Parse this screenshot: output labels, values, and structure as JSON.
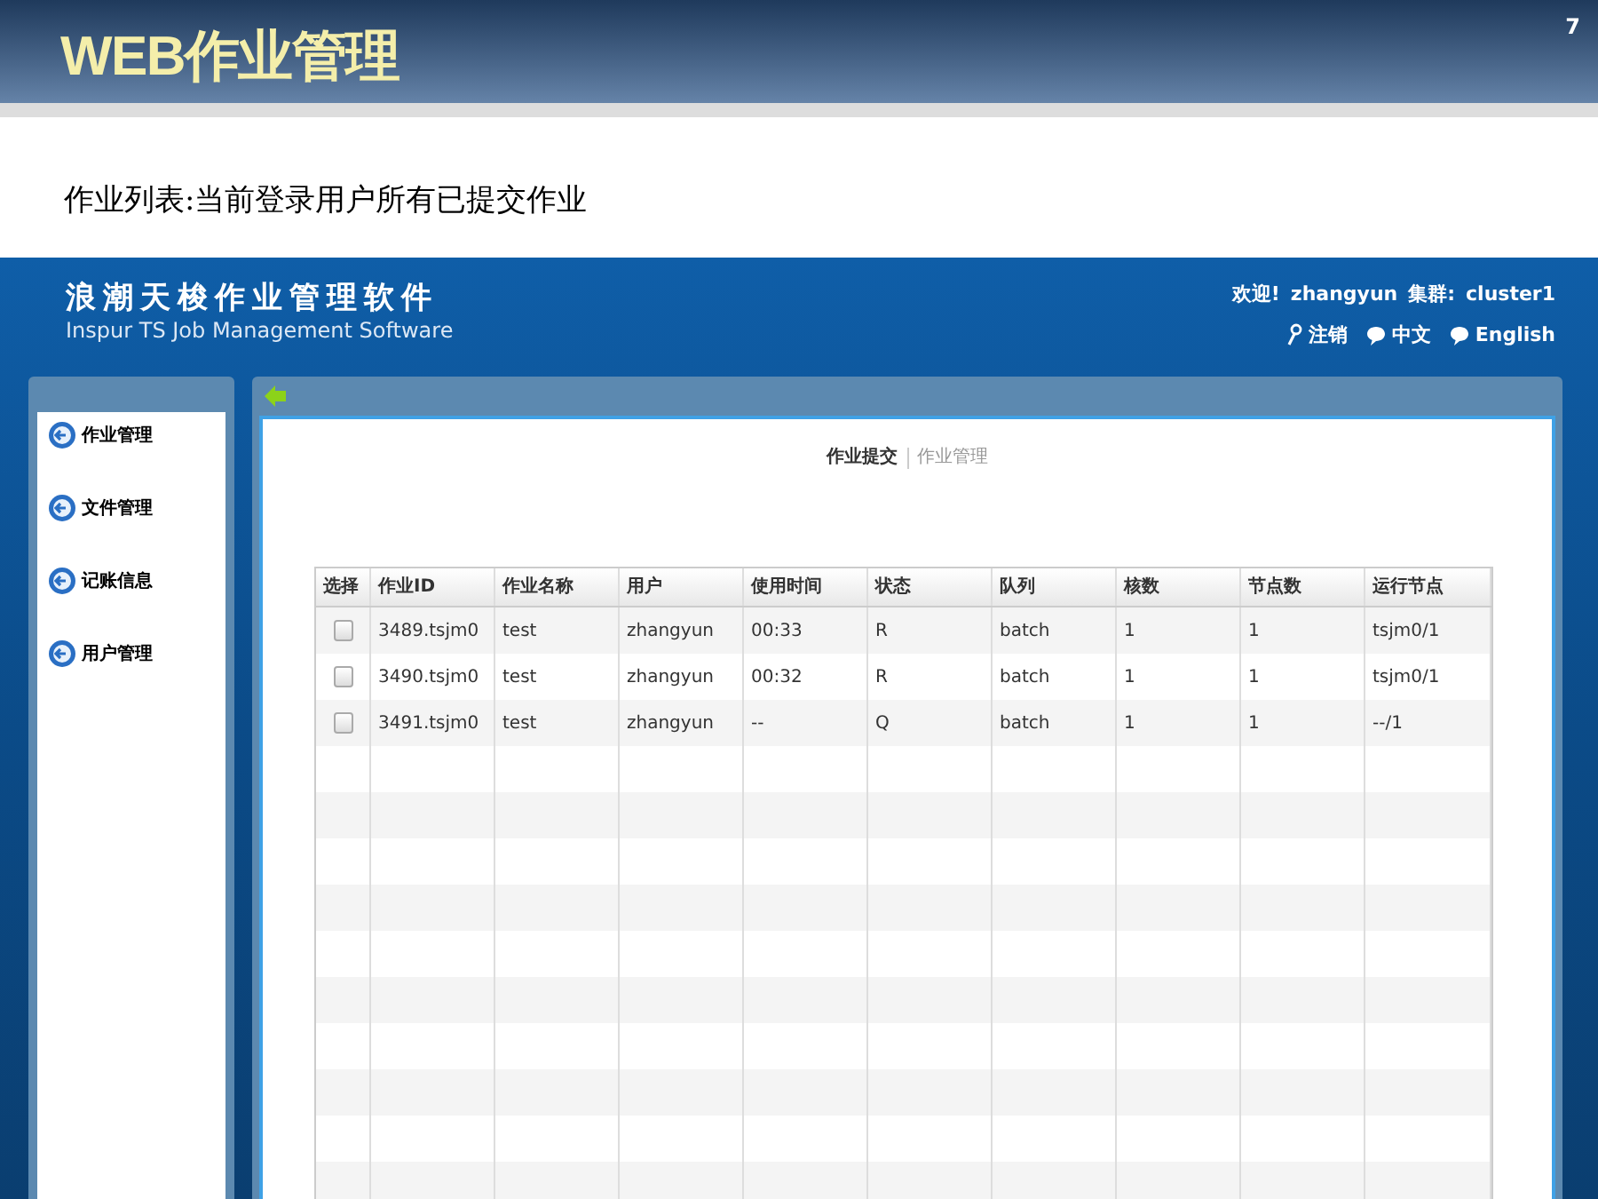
{
  "slide": {
    "title": "WEB作业管理",
    "page_number": "7",
    "subtitle": "作业列表:当前登录用户所有已提交作业"
  },
  "app": {
    "logo_title": "浪潮天梭作业管理软件",
    "logo_subtitle": "Inspur TS Job Management Software",
    "welcome": "欢迎!",
    "user": "zhangyun",
    "cluster_label": "集群:",
    "cluster": "cluster1",
    "links": [
      {
        "kind": "logout",
        "label": "注销"
      },
      {
        "kind": "language",
        "label": "中文"
      },
      {
        "kind": "language",
        "label": "English"
      }
    ],
    "sidebar": {
      "items": [
        {
          "label": "作业管理"
        },
        {
          "label": "文件管理"
        },
        {
          "label": "记账信息"
        },
        {
          "label": "用户管理"
        }
      ]
    },
    "tabs": [
      {
        "label": "作业提交",
        "selected": true
      },
      {
        "label": "作业管理",
        "selected": false
      }
    ],
    "table": {
      "columns": [
        "选择",
        "作业ID",
        "作业名称",
        "用户",
        "使用时间",
        "状态",
        "队列",
        "核数",
        "节点数",
        "运行节点"
      ],
      "rows": [
        {
          "checked": false,
          "cells": [
            "",
            "3489.tsjm0",
            "test",
            "zhangyun",
            "00:33",
            "R",
            "batch",
            "1",
            "1",
            "tsjm0/1"
          ]
        },
        {
          "checked": false,
          "cells": [
            "",
            "3490.tsjm0",
            "test",
            "zhangyun",
            "00:32",
            "R",
            "batch",
            "1",
            "1",
            "tsjm0/1"
          ]
        },
        {
          "checked": false,
          "cells": [
            "",
            "3491.tsjm0",
            "test",
            "zhangyun",
            "--",
            "Q",
            "batch",
            "1",
            "1",
            "--/1"
          ]
        }
      ]
    }
  }
}
